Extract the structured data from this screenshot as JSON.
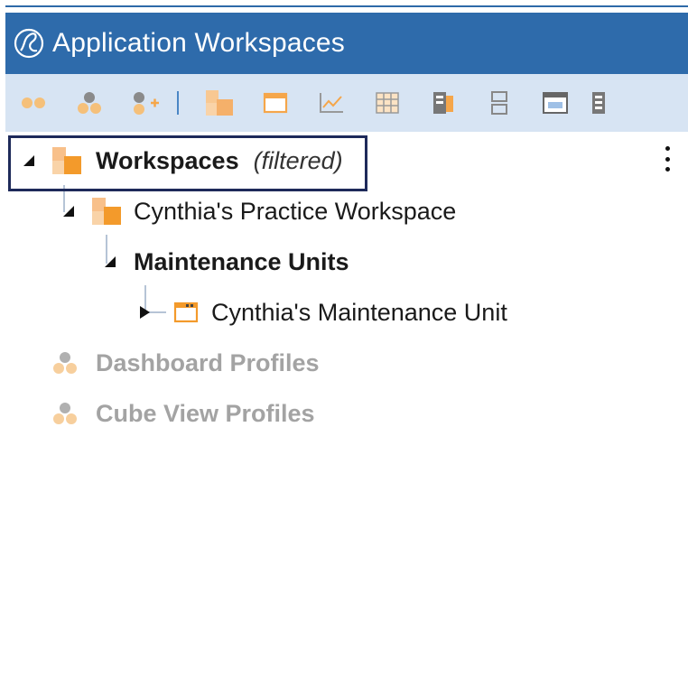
{
  "header": {
    "title": "Application Workspaces",
    "logo_icon": "onestream-logo-icon",
    "color": "#2e6bab"
  },
  "toolbar": {
    "background": "#d7e4f3",
    "buttons": [
      {
        "icon": "collapse-all-icon"
      },
      {
        "icon": "group-icon"
      },
      {
        "icon": "add-group-icon"
      },
      {
        "icon": "workspace-icon"
      },
      {
        "icon": "maintenance-unit-icon"
      },
      {
        "icon": "chart-icon"
      },
      {
        "icon": "grid-icon"
      },
      {
        "icon": "data-adapter-icon"
      },
      {
        "icon": "layout-icon"
      },
      {
        "icon": "dashboard-icon"
      },
      {
        "icon": "more-toolbar-icon"
      }
    ]
  },
  "tree": {
    "root": {
      "label": "Workspaces",
      "suffix": "(filtered)"
    },
    "workspace": {
      "label": "Cynthia's Practice Workspace"
    },
    "maintenance_units": {
      "label": "Maintenance Units"
    },
    "unit": {
      "label": "Cynthia's Maintenance Unit"
    },
    "dashboard_profiles": {
      "label": "Dashboard Profiles"
    },
    "cube_view_profiles": {
      "label": "Cube View Profiles"
    }
  },
  "colors": {
    "accent_orange": "#f39a2b",
    "disabled_gray": "#a3a3a3",
    "focus_border": "#1e2a5a"
  }
}
